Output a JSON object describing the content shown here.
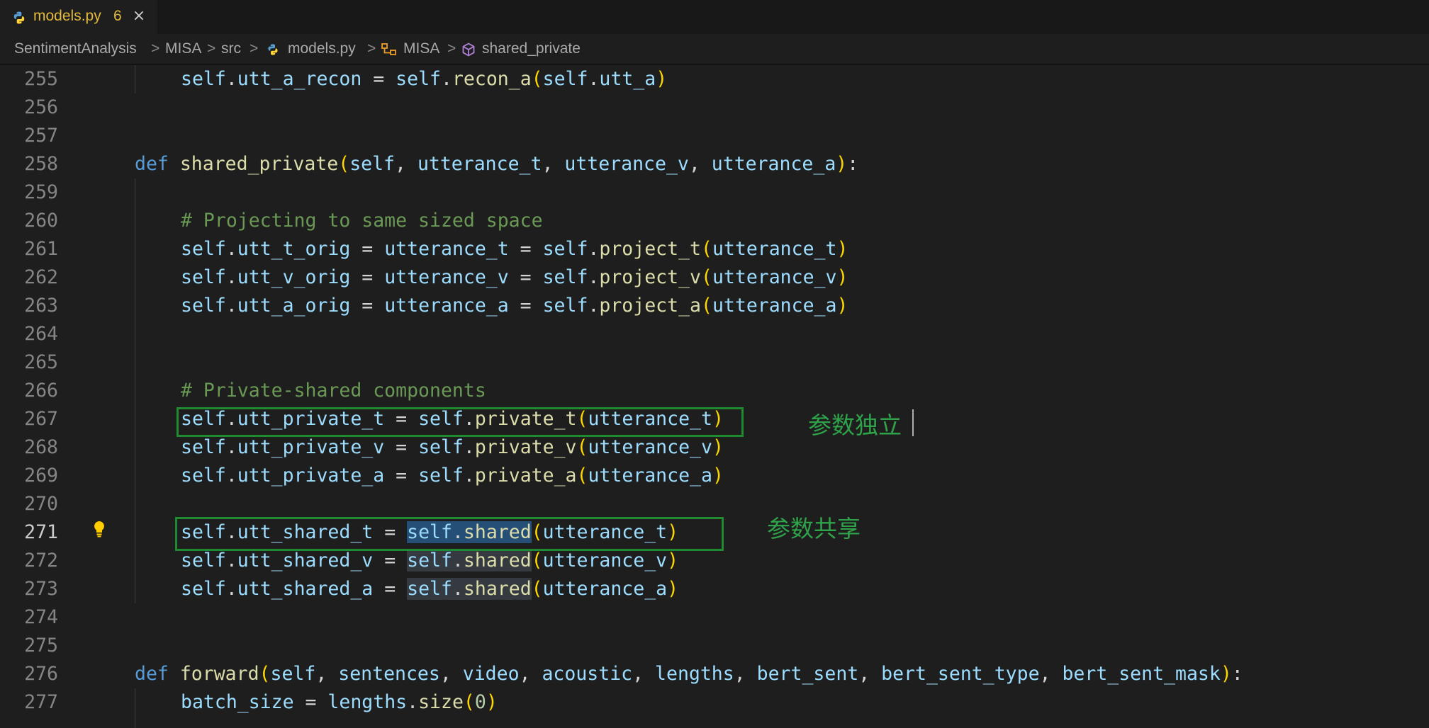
{
  "tab": {
    "filename": "models.py",
    "problem_count": "6",
    "close_glyph": "×",
    "icon": "python-icon"
  },
  "breadcrumbs": {
    "items": [
      "SentimentAnalysis",
      "MISA",
      "src",
      "models.py",
      "MISA",
      "shared_private"
    ],
    "separator": ">"
  },
  "lines": [
    {
      "num": "255",
      "html": "<span class='var'>self</span>.<span class='var'>utt_a_recon</span> = <span class='var'>self</span>.<span class='fn'>recon_a</span><span class='p1'>(</span><span class='var'>self</span>.<span class='var'>utt_a</span><span class='p1'>)</span>",
      "indent": 2
    },
    {
      "num": "256",
      "html": "",
      "indent": 0
    },
    {
      "num": "257",
      "html": "",
      "indent": 0
    },
    {
      "num": "258",
      "html": "<span class='kw'>def</span> <span class='fn'>shared_private</span><span class='p1'>(</span><span class='var'>self</span>, <span class='var'>utterance_t</span>, <span class='var'>utterance_v</span>, <span class='var'>utterance_a</span><span class='p1'>)</span>:",
      "indent": 1
    },
    {
      "num": "259",
      "html": "",
      "indent": 0
    },
    {
      "num": "260",
      "html": "<span class='cm'># Projecting to same sized space</span>",
      "indent": 2
    },
    {
      "num": "261",
      "html": "<span class='var'>self</span>.<span class='var'>utt_t_orig</span> = <span class='var'>utterance_t</span> = <span class='var'>self</span>.<span class='fn'>project_t</span><span class='p1'>(</span><span class='var'>utterance_t</span><span class='p1'>)</span>",
      "indent": 2
    },
    {
      "num": "262",
      "html": "<span class='var'>self</span>.<span class='var'>utt_v_orig</span> = <span class='var'>utterance_v</span> = <span class='var'>self</span>.<span class='fn'>project_v</span><span class='p1'>(</span><span class='var'>utterance_v</span><span class='p1'>)</span>",
      "indent": 2
    },
    {
      "num": "263",
      "html": "<span class='var'>self</span>.<span class='var'>utt_a_orig</span> = <span class='var'>utterance_a</span> = <span class='var'>self</span>.<span class='fn'>project_a</span><span class='p1'>(</span><span class='var'>utterance_a</span><span class='p1'>)</span>",
      "indent": 2
    },
    {
      "num": "264",
      "html": "",
      "indent": 0
    },
    {
      "num": "265",
      "html": "",
      "indent": 0
    },
    {
      "num": "266",
      "html": "<span class='cm'># Private-shared components</span>",
      "indent": 2
    },
    {
      "num": "267",
      "html": "<span class='var'>self</span>.<span class='var'>utt_private_t</span> = <span class='var'>self</span>.<span class='fn'>private_t</span><span class='p1'>(</span><span class='var'>utterance_t</span><span class='p1'>)</span>",
      "indent": 2
    },
    {
      "num": "268",
      "html": "<span class='var'>self</span>.<span class='var'>utt_private_v</span> = <span class='var'>self</span>.<span class='fn'>private_v</span><span class='p1'>(</span><span class='var'>utterance_v</span><span class='p1'>)</span>",
      "indent": 2
    },
    {
      "num": "269",
      "html": "<span class='var'>self</span>.<span class='var'>utt_private_a</span> = <span class='var'>self</span>.<span class='fn'>private_a</span><span class='p1'>(</span><span class='var'>utterance_a</span><span class='p1'>)</span>",
      "indent": 2
    },
    {
      "num": "270",
      "html": "",
      "indent": 0
    },
    {
      "num": "271",
      "html": "<span class='var'>self</span>.<span class='var'>utt_shared_t</span> = <span class='hl'><span class='var'>self</span>.<span class='fn'>shared</span></span><span class='p1'>(</span><span class='var'>utterance_t</span><span class='p1'>)</span>",
      "indent": 2
    },
    {
      "num": "272",
      "html": "<span class='var'>self</span>.<span class='var'>utt_shared_v</span> = <span class='hl2'><span class='var'>self</span>.<span class='fn'>shared</span></span><span class='p1'>(</span><span class='var'>utterance_v</span><span class='p1'>)</span>",
      "indent": 2
    },
    {
      "num": "273",
      "html": "<span class='var'>self</span>.<span class='var'>utt_shared_a</span> = <span class='hl2'><span class='var'>self</span>.<span class='fn'>shared</span></span><span class='p1'>(</span><span class='var'>utterance_a</span><span class='p1'>)</span>",
      "indent": 2
    },
    {
      "num": "274",
      "html": "",
      "indent": 0
    },
    {
      "num": "275",
      "html": "",
      "indent": 0
    },
    {
      "num": "276",
      "html": "<span class='kw'>def</span> <span class='fn'>forward</span><span class='p1'>(</span><span class='var'>self</span>, <span class='var'>sentences</span>, <span class='var'>video</span>, <span class='var'>acoustic</span>, <span class='var'>lengths</span>, <span class='var'>bert_sent</span>, <span class='var'>bert_sent_type</span>, <span class='var'>bert_sent_mask</span><span class='p1'>)</span>:",
      "indent": 1
    },
    {
      "num": "277",
      "html": "<span class='var'>batch_size</span> = <span class='var'>lengths</span>.<span class='fn'>size</span><span class='p1'>(</span><span class='num'>0</span><span class='p1'>)</span>",
      "indent": 2
    }
  ],
  "active_line": "271",
  "annotations": {
    "private_note": "参数独立",
    "shared_note": "参数共享"
  },
  "colors": {
    "annotation_green": "#2fa34a",
    "box_green": "#1f8a2f",
    "tab_text": "#e2b93d"
  }
}
